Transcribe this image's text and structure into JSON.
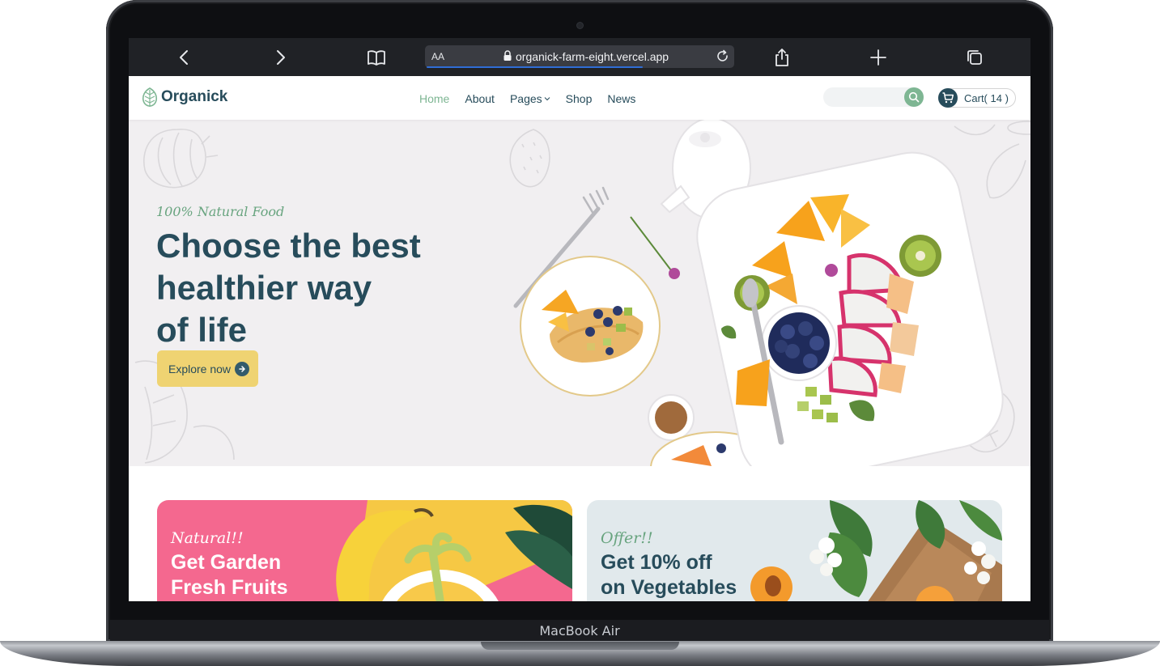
{
  "device": {
    "label": "MacBook Air"
  },
  "browser": {
    "text_size_label": "AA",
    "url": "organick-farm-eight.vercel.app",
    "icons": [
      "back-icon",
      "forward-icon",
      "bookmarks-icon",
      "lock-icon",
      "reload-icon",
      "share-icon",
      "new-tab-icon",
      "tabs-icon"
    ],
    "load_progress": 0.7
  },
  "header": {
    "logo": "Organick",
    "nav": [
      {
        "label": "Home",
        "active": true
      },
      {
        "label": "About"
      },
      {
        "label": "Pages",
        "has_dropdown": true
      },
      {
        "label": "Shop"
      },
      {
        "label": "News"
      }
    ],
    "search": {
      "placeholder": "",
      "icon": "search-icon"
    },
    "cart_label": "Cart( 14 )"
  },
  "hero": {
    "tag": "100% Natural Food",
    "title_lines": [
      "Choose the best",
      "healthier way",
      "of life"
    ],
    "button_label": "Explore now"
  },
  "banners": [
    {
      "tag": "Natural!!",
      "title_lines": [
        "Get Garden",
        "Fresh Fruits"
      ]
    },
    {
      "tag": "Offer!!",
      "title_lines": [
        "Get 10% off",
        "on Vegetables"
      ]
    }
  ],
  "colors": {
    "primary": "#274c5b",
    "accent_green": "#7eb693",
    "button_yellow": "#efd372",
    "banner_pink": "#f4688f",
    "banner_grey": "#e1e9ec"
  }
}
